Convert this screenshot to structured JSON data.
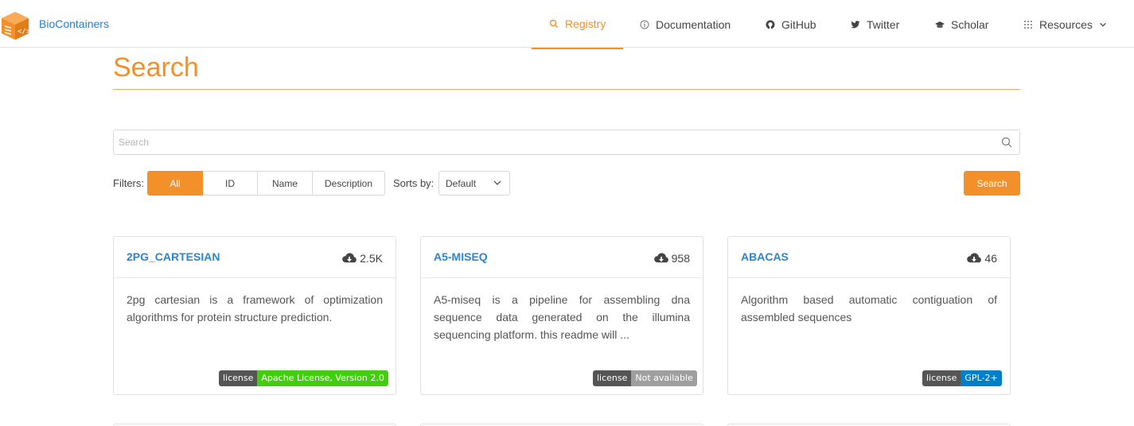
{
  "header": {
    "brand": "BioContainers",
    "nav": [
      {
        "label": "Registry",
        "icon": "search-icon"
      },
      {
        "label": "Documentation",
        "icon": "info-icon"
      },
      {
        "label": "GitHub",
        "icon": "github-icon"
      },
      {
        "label": "Twitter",
        "icon": "twitter-icon"
      },
      {
        "label": "Scholar",
        "icon": "graduation-cap-icon"
      },
      {
        "label": "Resources",
        "icon": "grid-icon"
      }
    ]
  },
  "main": {
    "title": "Search",
    "search_placeholder": "Search",
    "filters_label": "Filters:",
    "filters": [
      "All",
      "ID",
      "Name",
      "Description"
    ],
    "active_filter": "All",
    "sorts_label": "Sorts by:",
    "sort_value": "Default",
    "search_button": "Search"
  },
  "cards": [
    {
      "title": "2PG_CARTESIAN",
      "downloads": "2.5K",
      "description": "2pg cartesian is a framework of optimization algorithms for protein structure prediction.",
      "license_label": "license",
      "license_value": "Apache License, Version 2.0",
      "license_color": "#4c1"
    },
    {
      "title": "A5-MISEQ",
      "downloads": "958",
      "description": "A5-miseq is a pipeline for assembling dna sequence data generated on the illumina sequencing platform. this readme will ...",
      "license_label": "license",
      "license_value": "Not available",
      "license_color": "#9f9f9f"
    },
    {
      "title": "ABACAS",
      "downloads": "46",
      "description": "Algorithm based automatic contiguation of assembled sequences",
      "license_label": "license",
      "license_value": "GPL-2+",
      "license_color": "#007ec6"
    }
  ],
  "colors": {
    "accent": "#f4902a",
    "link": "#2a85d0"
  }
}
